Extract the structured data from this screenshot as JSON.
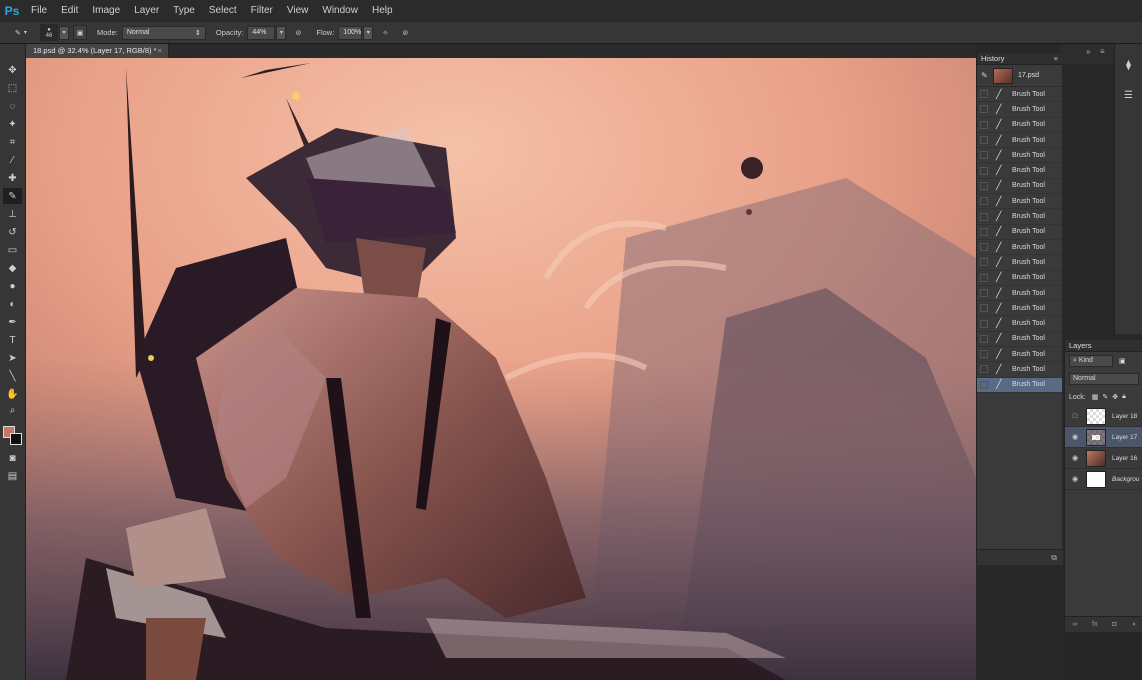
{
  "app": {
    "logo": "Ps"
  },
  "menu": [
    "File",
    "Edit",
    "Image",
    "Layer",
    "Type",
    "Select",
    "Filter",
    "View",
    "Window",
    "Help"
  ],
  "options": {
    "brush_size": "46",
    "mode_label": "Mode:",
    "mode_value": "Normal",
    "opacity_label": "Opacity:",
    "opacity_value": "44%",
    "flow_label": "Flow:",
    "flow_value": "100%"
  },
  "document": {
    "tab_title": "18.psd @ 32.4% (Layer 17, RGB/8) *",
    "close": "×"
  },
  "history": {
    "title": "History",
    "snapshot": "17.psd",
    "items": [
      "Brush Tool",
      "Brush Tool",
      "Brush Tool",
      "Brush Tool",
      "Brush Tool",
      "Brush Tool",
      "Brush Tool",
      "Brush Tool",
      "Brush Tool",
      "Brush Tool",
      "Brush Tool",
      "Brush Tool",
      "Brush Tool",
      "Brush Tool",
      "Brush Tool",
      "Brush Tool",
      "Brush Tool",
      "Brush Tool",
      "Brush Tool",
      "Brush Tool"
    ],
    "selected_index": 19
  },
  "layers": {
    "title": "Layers",
    "kind": "Kind",
    "blend": "Normal",
    "lock_label": "Lock:",
    "items": [
      {
        "name": "Layer 18",
        "visible": false
      },
      {
        "name": "Layer 17",
        "visible": true,
        "selected": true
      },
      {
        "name": "Layer 16",
        "visible": true
      },
      {
        "name": "Backgrou",
        "visible": true
      }
    ]
  },
  "colors": {
    "foreground": "#c8775f",
    "background": "#111111",
    "selection": "#586a86"
  }
}
